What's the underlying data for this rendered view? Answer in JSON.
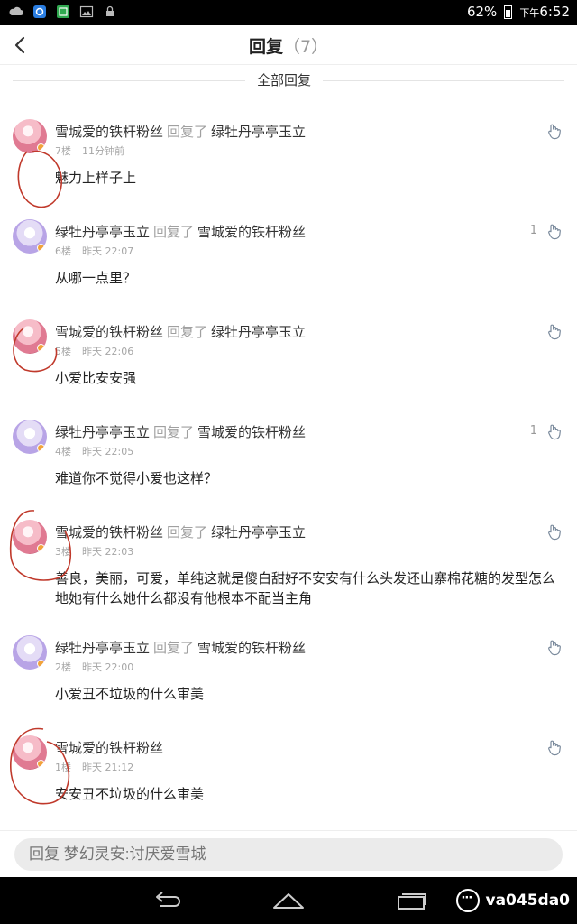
{
  "status_bar": {
    "battery": "62%",
    "time_prefix": "下午",
    "time": "6:52"
  },
  "header": {
    "title": "回复",
    "count": "（7）"
  },
  "section": {
    "title": "全部回复"
  },
  "replies": [
    {
      "user": "雪城爱的铁杆粉丝",
      "verb": "回复了",
      "target": "绿牡丹亭亭玉立",
      "floor": "7楼",
      "time": "11分钟前",
      "text": "魅力上样子上",
      "likes": "",
      "avatar": "pink"
    },
    {
      "user": "绿牡丹亭亭玉立",
      "verb": "回复了",
      "target": "雪城爱的铁杆粉丝",
      "floor": "6楼",
      "time": "昨天 22:07",
      "text": "从哪一点里？",
      "likes": "1",
      "avatar": "purple"
    },
    {
      "user": "雪城爱的铁杆粉丝",
      "verb": "回复了",
      "target": "绿牡丹亭亭玉立",
      "floor": "5楼",
      "time": "昨天 22:06",
      "text": "小爱比安安强",
      "likes": "",
      "avatar": "pink"
    },
    {
      "user": "绿牡丹亭亭玉立",
      "verb": "回复了",
      "target": "雪城爱的铁杆粉丝",
      "floor": "4楼",
      "time": "昨天 22:05",
      "text": "难道你不觉得小爱也这样？",
      "likes": "1",
      "avatar": "purple"
    },
    {
      "user": "雪城爱的铁杆粉丝",
      "verb": "回复了",
      "target": "绿牡丹亭亭玉立",
      "floor": "3楼",
      "time": "昨天 22:03",
      "text": "善良，美丽，可爱，单纯这就是傻白甜好不安安有什么头发还山寨棉花糖的发型怎么地她有什么她什么都没有他根本不配当主角",
      "likes": "",
      "avatar": "pink"
    },
    {
      "user": "绿牡丹亭亭玉立",
      "verb": "回复了",
      "target": "雪城爱的铁杆粉丝",
      "floor": "2楼",
      "time": "昨天 22:00",
      "text": "小爱丑不垃圾的什么审美",
      "likes": "",
      "avatar": "purple"
    },
    {
      "user": "雪城爱的铁杆粉丝",
      "verb": "",
      "target": "",
      "floor": "1楼",
      "time": "昨天 21:12",
      "text": "安安丑不垃圾的什么审美",
      "likes": "",
      "avatar": "pink"
    }
  ],
  "reply_input": {
    "placeholder": "回复 梦幻灵安:讨厌爱雪城"
  },
  "watermark": {
    "text": "va045da0"
  },
  "colors": {
    "status_bar": "#000000",
    "name_text": "#333333",
    "secondary_text": "#a0a0a0",
    "input_bg": "#ebebeb",
    "ink_mark": "#c0392b"
  }
}
